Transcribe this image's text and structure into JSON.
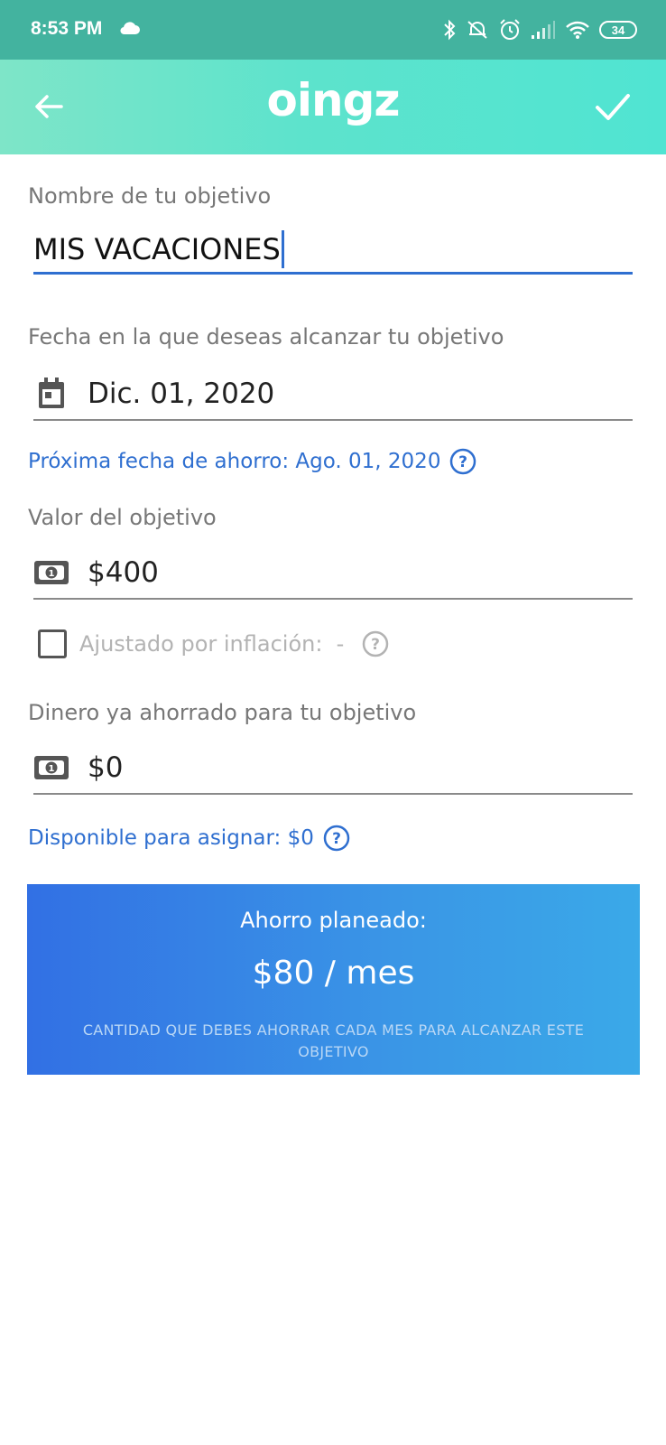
{
  "status_bar": {
    "time": "8:53 PM",
    "battery": "34",
    "icons": [
      "cloud-icon",
      "bluetooth-icon",
      "silent-icon",
      "alarm-icon",
      "signal-icon",
      "wifi-icon",
      "battery-icon"
    ]
  },
  "appbar": {
    "logo": "oingz",
    "back_icon": "arrow-left-icon",
    "confirm_icon": "check-icon",
    "background_color": "#5de3cc"
  },
  "form": {
    "goal_name_label": "Nombre de tu objetivo",
    "goal_name_value": "MIS VACACIONES",
    "date_label": "Fecha en la que deseas alcanzar tu objetivo",
    "date_value": "Dic. 01, 2020",
    "next_saving_date": "Próxima fecha de ahorro: Ago. 01, 2020",
    "goal_value_label": "Valor del objetivo",
    "goal_value": "$400",
    "inflation_label": "Ajustado por inflación:  -",
    "inflation_checked": false,
    "saved_label": "Dinero ya ahorrado para tu objetivo",
    "saved_value": "$0",
    "available": "Disponible para asignar: $0"
  },
  "plan": {
    "title": "Ahorro planeado:",
    "amount": "$80 / mes",
    "note": "CANTIDAD QUE DEBES AHORRAR CADA MES PARA ALCANZAR ESTE OBJETIVO"
  },
  "colors": {
    "accent": "#2f6fd0",
    "status_bar": "#43b39f",
    "card_start": "#3270e4",
    "card_end": "#3aa9e8"
  }
}
